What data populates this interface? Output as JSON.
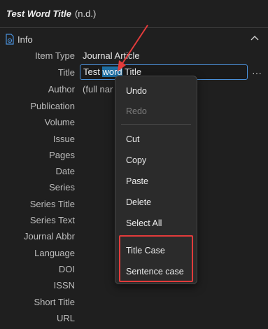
{
  "header": {
    "title": "Test Word Title",
    "subtitle": "(n.d.)"
  },
  "section": {
    "label": "Info",
    "icon": "info-document-icon",
    "collapse_icon": "chevron-up-icon"
  },
  "fields": [
    {
      "label": "Item Type",
      "value": "Journal Article"
    },
    {
      "label": "Title",
      "value": "Test word Title"
    },
    {
      "label": "Author",
      "value": "(full nar"
    },
    {
      "label": "Publication",
      "value": ""
    },
    {
      "label": "Volume",
      "value": ""
    },
    {
      "label": "Issue",
      "value": ""
    },
    {
      "label": "Pages",
      "value": ""
    },
    {
      "label": "Date",
      "value": ""
    },
    {
      "label": "Series",
      "value": ""
    },
    {
      "label": "Series Title",
      "value": ""
    },
    {
      "label": "Series Text",
      "value": ""
    },
    {
      "label": "Journal Abbr",
      "value": ""
    },
    {
      "label": "Language",
      "value": ""
    },
    {
      "label": "DOI",
      "value": ""
    },
    {
      "label": "ISSN",
      "value": ""
    },
    {
      "label": "Short Title",
      "value": ""
    },
    {
      "label": "URL",
      "value": ""
    }
  ],
  "title_input": {
    "before": "Test ",
    "selected": "word",
    "after": " Title"
  },
  "more_button": "···",
  "context_menu": {
    "undo": "Undo",
    "redo": "Redo",
    "cut": "Cut",
    "copy": "Copy",
    "paste": "Paste",
    "delete": "Delete",
    "select_all": "Select All",
    "title_case": "Title Case",
    "sentence_case": "Sentence case"
  },
  "colors": {
    "accent": "#4a90d9",
    "highlight_box": "#e23b3b",
    "arrow": "#e23b3b",
    "selection": "#1e6fa3"
  }
}
